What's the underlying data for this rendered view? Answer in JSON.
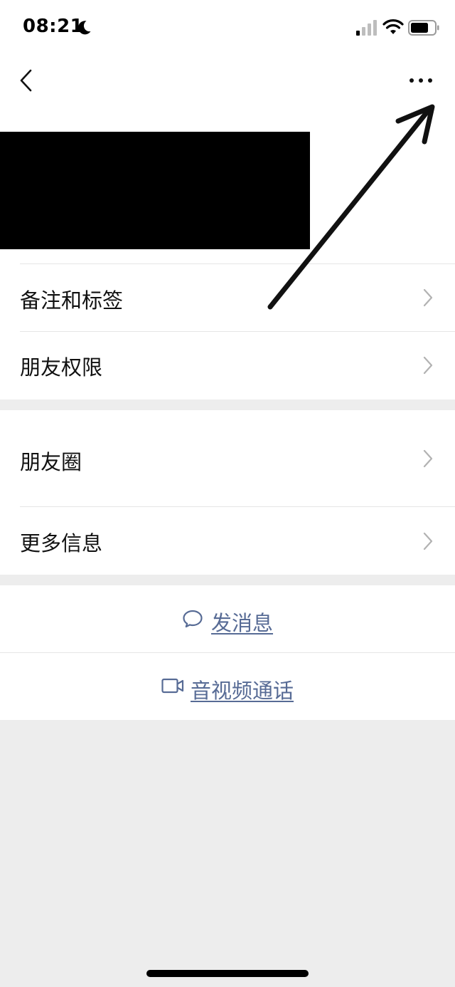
{
  "status_bar": {
    "time": "08:21",
    "icons": [
      "moon-icon",
      "signal-icon",
      "wifi-icon",
      "battery-icon"
    ]
  },
  "header": {
    "back_icon": "chevron-left-icon",
    "more_icon": "more-dots-icon"
  },
  "profile": {
    "redacted": true
  },
  "groups": [
    {
      "items": [
        {
          "label": "备注和标签",
          "icon": "chevron-right-icon"
        },
        {
          "label": "朋友权限",
          "icon": "chevron-right-icon"
        }
      ]
    },
    {
      "items": [
        {
          "label": "朋友圈",
          "icon": "chevron-right-icon"
        },
        {
          "label": "更多信息",
          "icon": "chevron-right-icon"
        }
      ]
    }
  ],
  "actions": [
    {
      "label": "发消息",
      "icon": "chat-bubble-icon"
    },
    {
      "label": "音视频通话",
      "icon": "video-camera-icon"
    }
  ],
  "colors": {
    "background": "#ededed",
    "card": "#ffffff",
    "link": "#576b95",
    "chevron": "#b2b2b2",
    "divider": "#e5e5e5"
  }
}
